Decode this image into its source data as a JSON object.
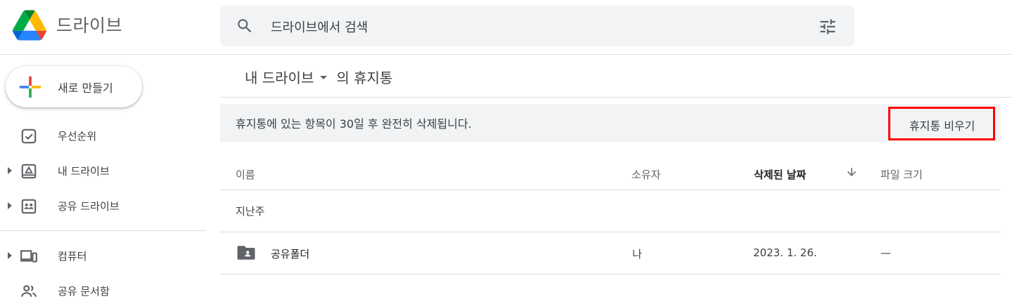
{
  "app": {
    "name": "드라이브"
  },
  "search": {
    "placeholder": "드라이브에서 검색"
  },
  "sidebar": {
    "new_label": "새로 만들기",
    "items": [
      {
        "label": "우선순위",
        "icon": "priority-check-icon"
      },
      {
        "label": "내 드라이브",
        "icon": "my-drive-icon"
      },
      {
        "label": "공유 드라이브",
        "icon": "shared-drive-icon"
      },
      {
        "label": "컴퓨터",
        "icon": "computer-icon"
      },
      {
        "label": "공유 문서함",
        "icon": "people-icon"
      }
    ]
  },
  "main": {
    "breadcrumb": {
      "drive": "내 드라이브",
      "suffix": "의 휴지통"
    },
    "banner": {
      "message": "휴지통에 있는 항목이 30일 후 완전히 삭제됩니다.",
      "empty_trash_label": "휴지통 비우기"
    },
    "columns": {
      "name": "이름",
      "owner": "소유자",
      "deleted_date": "삭제된 날짜",
      "size": "파일 크기"
    },
    "groups": [
      {
        "label": "지난주",
        "rows": [
          {
            "name": "공유폴더",
            "owner": "나",
            "deleted_date": "2023. 1. 26.",
            "size": "—"
          }
        ]
      }
    ]
  },
  "colors": {
    "accent_red": "#ff0000",
    "google_blue": "#4285f4",
    "google_green": "#34a853",
    "google_yellow": "#fbbc04",
    "google_red": "#ea4335"
  }
}
